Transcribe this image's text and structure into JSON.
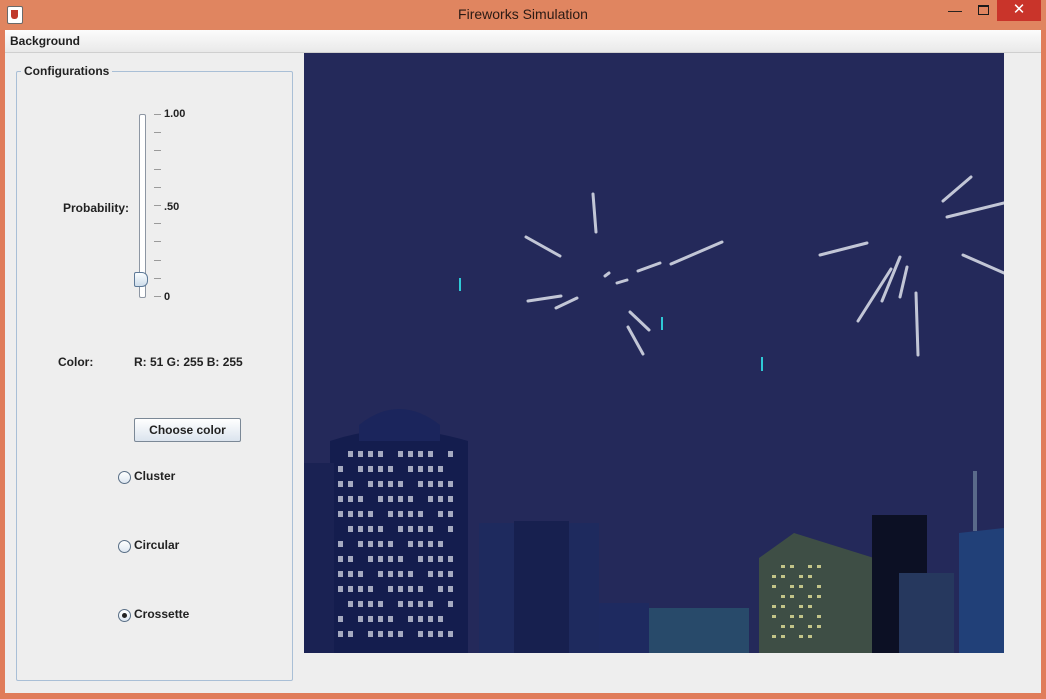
{
  "window": {
    "title": "Fireworks Simulation",
    "minimize_symbol": "—",
    "close_symbol": "✕"
  },
  "menubar": {
    "items": [
      {
        "label": "Background"
      }
    ]
  },
  "config": {
    "title": "Configurations",
    "probability": {
      "label": "Probability:",
      "value": 0.1,
      "min": 0,
      "max": 1,
      "tick_labels": [
        "1.00",
        ".50",
        "0"
      ]
    },
    "color": {
      "label": "Color:",
      "value_text": "R: 51  G: 255  B: 255"
    },
    "choose_color_label": "Choose color",
    "radios": [
      {
        "label": "Cluster",
        "selected": false
      },
      {
        "label": "Circular",
        "selected": false
      },
      {
        "label": "Crossette",
        "selected": true
      }
    ]
  },
  "canvas": {
    "sky_color": "#24295a",
    "spark_color": "#d4d8e4",
    "particle_color": "#33ffff"
  }
}
